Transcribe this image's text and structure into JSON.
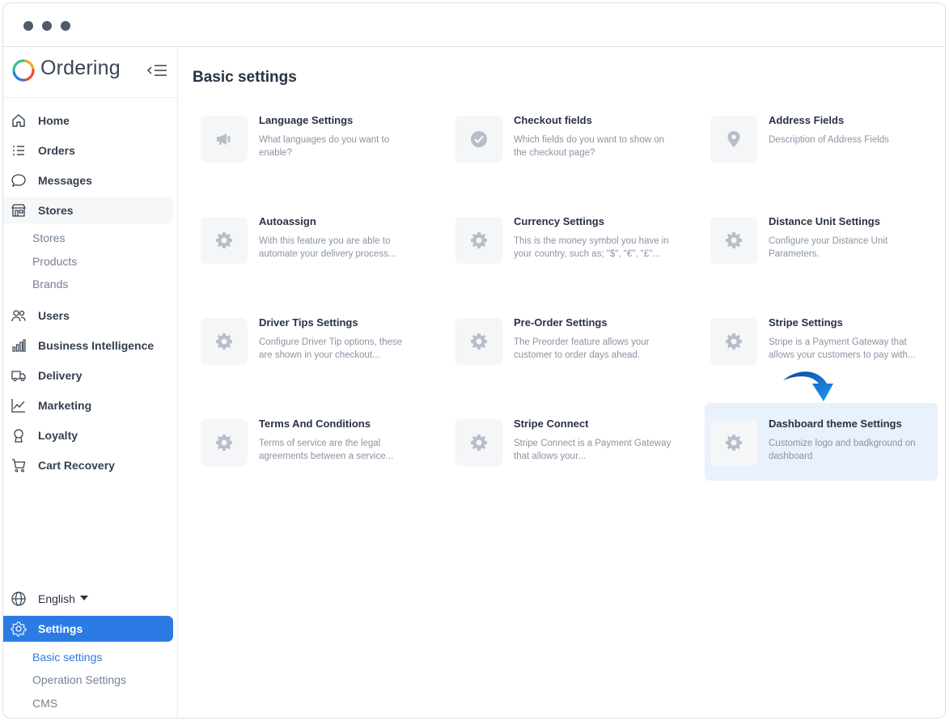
{
  "app": {
    "name": "Ordering"
  },
  "sidebar": {
    "main_items": [
      {
        "label": "Home",
        "icon": "home-icon"
      },
      {
        "label": "Orders",
        "icon": "list-icon"
      },
      {
        "label": "Messages",
        "icon": "chat-icon"
      },
      {
        "label": "Stores",
        "icon": "store-icon"
      }
    ],
    "stores_sub": [
      "Stores",
      "Products",
      "Brands"
    ],
    "more_items": [
      {
        "label": "Users",
        "icon": "users-icon"
      },
      {
        "label": "Business Intelligence",
        "icon": "bar-chart-icon"
      },
      {
        "label": "Delivery",
        "icon": "truck-icon"
      },
      {
        "label": "Marketing",
        "icon": "line-chart-icon"
      },
      {
        "label": "Loyalty",
        "icon": "award-icon"
      },
      {
        "label": "Cart Recovery",
        "icon": "cart-icon"
      }
    ],
    "language": "English",
    "settings": {
      "label": "Settings",
      "icon": "gear-icon"
    },
    "settings_sub": [
      "Basic settings",
      "Operation Settings",
      "CMS"
    ]
  },
  "main": {
    "title": "Basic settings",
    "cards": [
      {
        "title": "Language Settings",
        "desc": "What languages do you want to enable?",
        "icon": "megaphone-icon"
      },
      {
        "title": "Checkout fields",
        "desc": "Which fields do you want to show on the checkout page?",
        "icon": "check-circle-icon"
      },
      {
        "title": "Address Fields",
        "desc": "Description of Address Fields",
        "icon": "map-pin-icon"
      },
      {
        "title": "Autoassign",
        "desc": "With this feature you are able to automate your delivery process...",
        "icon": "gear-icon"
      },
      {
        "title": "Currency Settings",
        "desc": "This is the money symbol you have in your country, such as; \"$\", \"€\", \"£\"...",
        "icon": "gear-icon"
      },
      {
        "title": "Distance Unit Settings",
        "desc": "Configure your Distance Unit Parameters.",
        "icon": "gear-icon"
      },
      {
        "title": "Driver Tips Settings",
        "desc": "Configure Driver Tip options, these are shown in your checkout...",
        "icon": "gear-icon"
      },
      {
        "title": "Pre-Order Settings",
        "desc": "The Preorder feature allows your customer to order days ahead.",
        "icon": "gear-icon"
      },
      {
        "title": "Stripe Settings",
        "desc": "Stripe is a Payment Gateway that allows your customers to pay with...",
        "icon": "gear-icon"
      },
      {
        "title": "Terms And Conditions",
        "desc": "Terms of service are the legal agreements between a service...",
        "icon": "gear-icon"
      },
      {
        "title": "Stripe Connect",
        "desc": "Stripe Connect is a Payment Gateway that allows your...",
        "icon": "gear-icon"
      },
      {
        "title": "Dashboard theme Settings",
        "desc": "Customize logo and badkground on dashboard",
        "icon": "gear-icon"
      }
    ]
  },
  "colors": {
    "accent": "#2c7be5",
    "selected_bg": "#e9f1fc",
    "arrow": "#2196f3"
  }
}
